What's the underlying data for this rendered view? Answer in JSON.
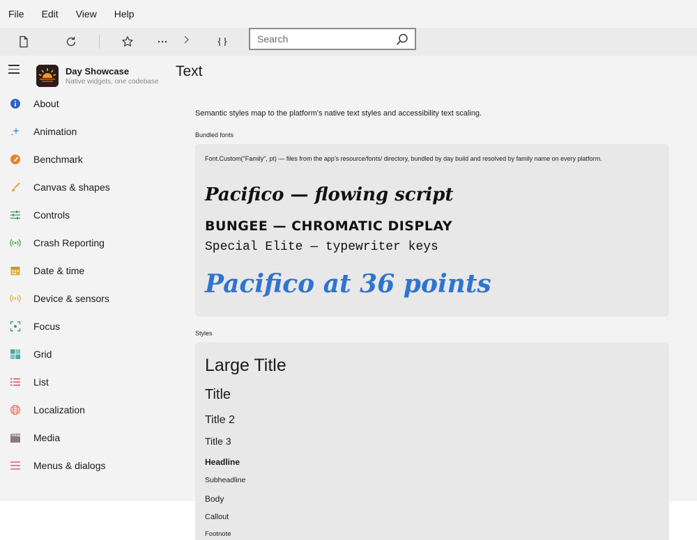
{
  "menubar": {
    "items": [
      "File",
      "Edit",
      "View",
      "Help"
    ]
  },
  "toolbar": {
    "search_placeholder": "Search"
  },
  "app": {
    "name": "Day Showcase",
    "tagline": "Native widgets, one codebase"
  },
  "sidebar": {
    "items": [
      {
        "label": "About",
        "icon": "info-icon",
        "color": "#2f63c8"
      },
      {
        "label": "Animation",
        "icon": "sparkles-icon",
        "color": "#6aa0e8"
      },
      {
        "label": "Benchmark",
        "icon": "gauge-icon",
        "color": "#e8842a"
      },
      {
        "label": "Canvas & shapes",
        "icon": "brush-icon",
        "color": "#e6a23c"
      },
      {
        "label": "Controls",
        "icon": "sliders-icon",
        "color": "#3c9a5c"
      },
      {
        "label": "Crash Reporting",
        "icon": "broadcast-icon",
        "color": "#3caa5c"
      },
      {
        "label": "Date & time",
        "icon": "calendar-icon",
        "color": "#d9b23a"
      },
      {
        "label": "Device & sensors",
        "icon": "sensor-icon",
        "color": "#e0b23c"
      },
      {
        "label": "Focus",
        "icon": "focus-icon",
        "color": "#3c9a8a"
      },
      {
        "label": "Grid",
        "icon": "grid-icon",
        "color": "#4aa8a0"
      },
      {
        "label": "List",
        "icon": "list-icon",
        "color": "#e04a4a"
      },
      {
        "label": "Localization",
        "icon": "globe-icon",
        "color": "#e87a6a"
      },
      {
        "label": "Media",
        "icon": "clapper-icon",
        "color": "#8a7a78"
      },
      {
        "label": "Menus & dialogs",
        "icon": "menu-lines-icon",
        "color": "#e05a7a"
      }
    ]
  },
  "page": {
    "title": "Text",
    "intro": "Semantic styles map to the platform's native text styles and accessibility text scaling.",
    "bundled_heading": "Bundled fonts",
    "bundled_desc": "Font.Custom(\"Family\", pt) — files from the app's resource/fonts/ directory, bundled by day build and resolved by family name on every platform.",
    "font_pacifico": "Pacifico — flowing script",
    "font_bungee": "BUNGEE — CHROMATIC DISPLAY",
    "font_elite": "Special Elite — typewriter keys",
    "font_pacifico36": "Pacifico at 36 points",
    "styles_heading": "Styles",
    "styles": {
      "large_title": "Large Title",
      "title": "Title",
      "title2": "Title 2",
      "title3": "Title 3",
      "headline": "Headline",
      "subheadline": "Subheadline",
      "body": "Body",
      "callout": "Callout",
      "footnote": "Footnote"
    }
  }
}
